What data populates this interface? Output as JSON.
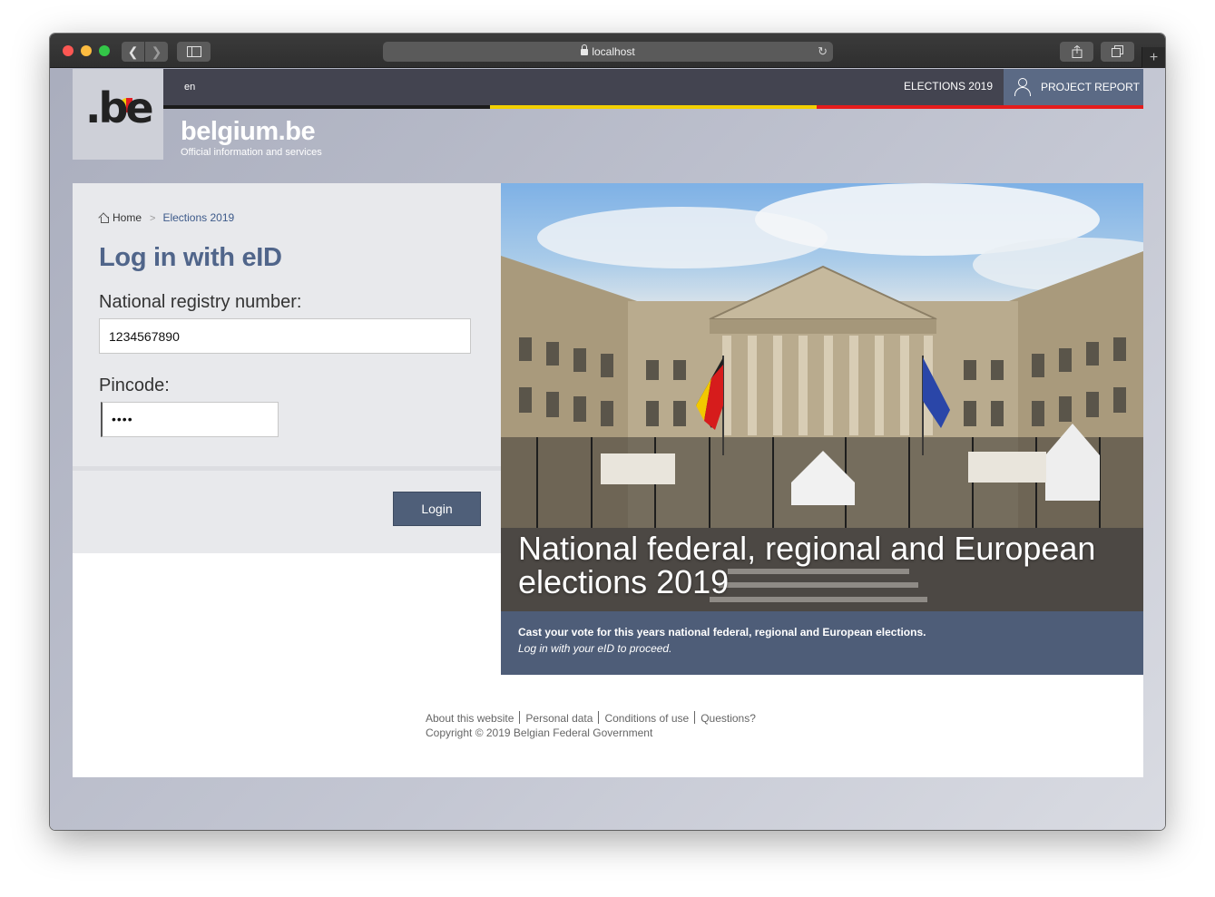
{
  "browser": {
    "url": "localhost",
    "back_icon": "chevron-left-icon",
    "forward_icon": "chevron-right-icon",
    "reload_icon": "reload-icon",
    "newtab_label": "+"
  },
  "site": {
    "logo": ".be",
    "brand_name": "belgium.be",
    "brand_tagline": "Official information and services",
    "language": "en",
    "nav": {
      "elections": "ELECTIONS 2019",
      "project_report": "PROJECT REPORT"
    },
    "colors": {
      "flag_black": "#1b1b1b",
      "flag_yellow": "#f2d000",
      "flag_red": "#e51c1c",
      "accent": "#4f5f79",
      "title": "#50658a"
    }
  },
  "breadcrumb": {
    "home": "Home",
    "separator": ">",
    "current": "Elections 2019"
  },
  "login": {
    "title": "Log in with eID",
    "nrn_label": "National registry number:",
    "nrn_value": "1234567890",
    "pin_label": "Pincode:",
    "pin_value": "••••",
    "button": "Login"
  },
  "hero": {
    "title": "National federal, regional and European elections 2019",
    "caption_main": "Cast your vote for this years national federal, regional and European elections.",
    "caption_sub": "Log in with your eID to proceed."
  },
  "footer": {
    "links": [
      "About this website",
      "Personal data",
      "Conditions of use",
      "Questions?"
    ],
    "copyright": "Copyright © 2019 Belgian Federal Government"
  }
}
